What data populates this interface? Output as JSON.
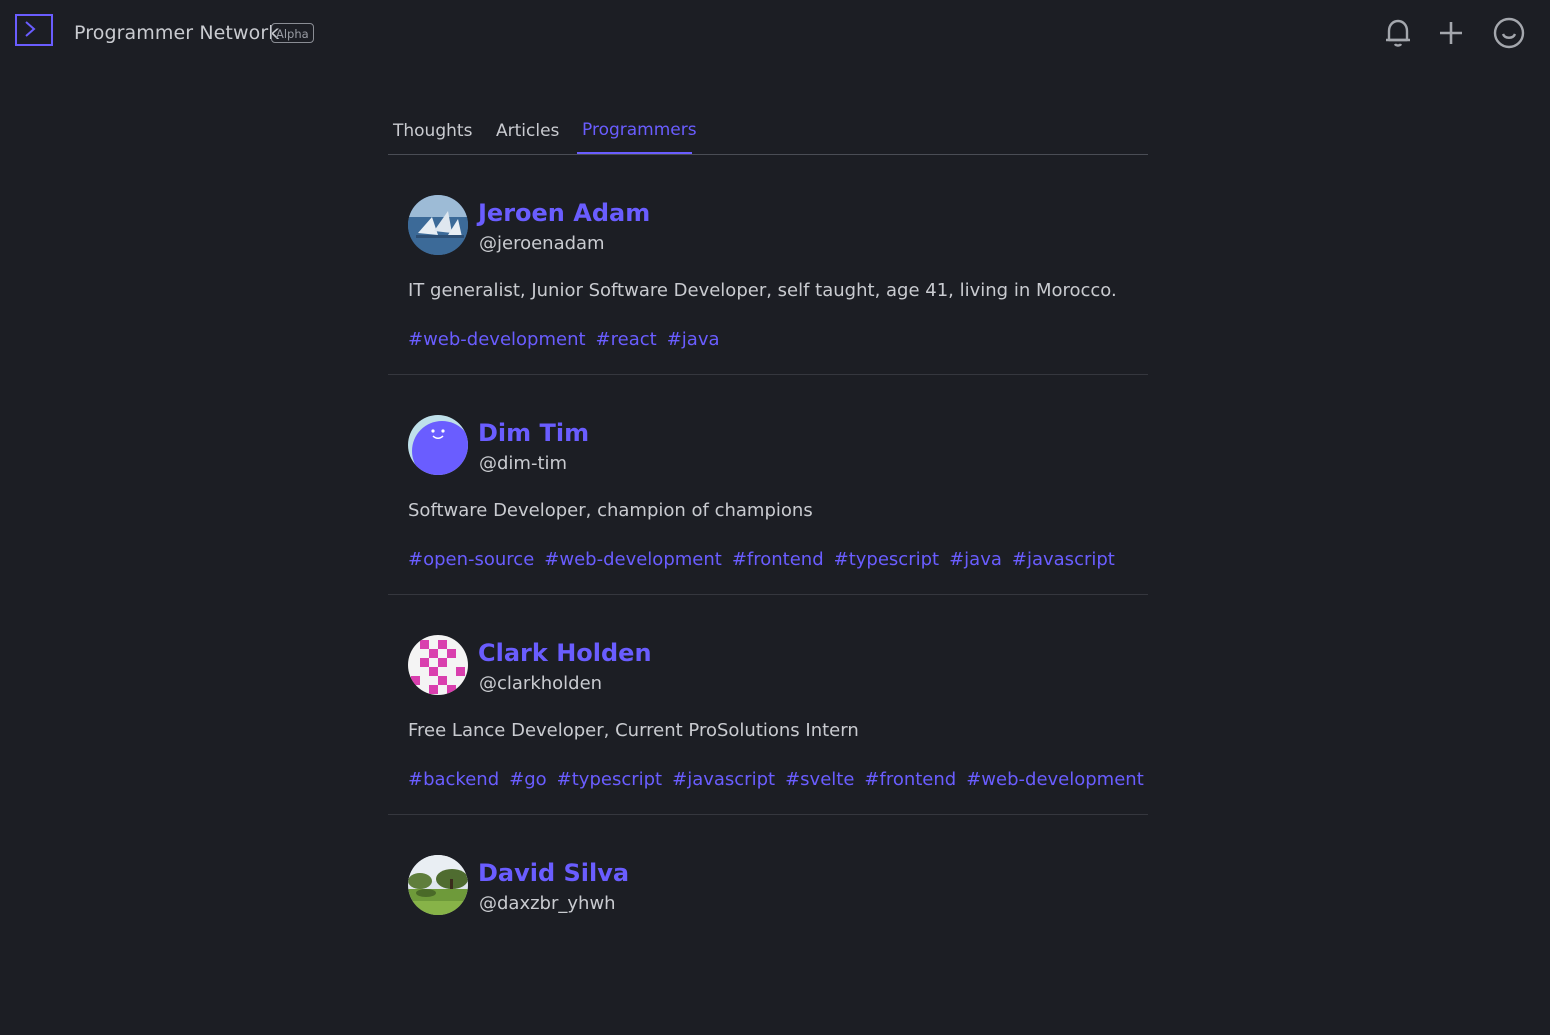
{
  "header": {
    "brand": "Programmer Network",
    "badge": "Alpha",
    "icons": [
      "bell-icon",
      "plus-icon",
      "smiley-icon"
    ]
  },
  "tabs": [
    {
      "label": "Thoughts",
      "active": false
    },
    {
      "label": "Articles",
      "active": false
    },
    {
      "label": "Programmers",
      "active": true
    }
  ],
  "colors": {
    "background": "#1c1e24",
    "accent": "#6a5dff",
    "text": "#c9cbd0"
  },
  "programmers": [
    {
      "name": "Jeroen Adam",
      "handle": "@jeroenadam",
      "bio": "IT generalist, Junior Software Developer, self taught, age 41, living in Morocco.",
      "tags": [
        "#web-development",
        "#react",
        "#java"
      ]
    },
    {
      "name": "Dim Tim",
      "handle": "@dim-tim",
      "bio": "Software Developer, champion of champions",
      "tags": [
        "#open-source",
        "#web-development",
        "#frontend",
        "#typescript",
        "#java",
        "#javascript"
      ]
    },
    {
      "name": "Clark Holden",
      "handle": "@clarkholden",
      "bio": "Free Lance Developer, Current ProSolutions Intern",
      "tags": [
        "#backend",
        "#go",
        "#typescript",
        "#javascript",
        "#svelte",
        "#frontend",
        "#web-development"
      ]
    },
    {
      "name": "David Silva",
      "handle": "@daxzbr_yhwh",
      "bio": "",
      "tags": []
    }
  ]
}
